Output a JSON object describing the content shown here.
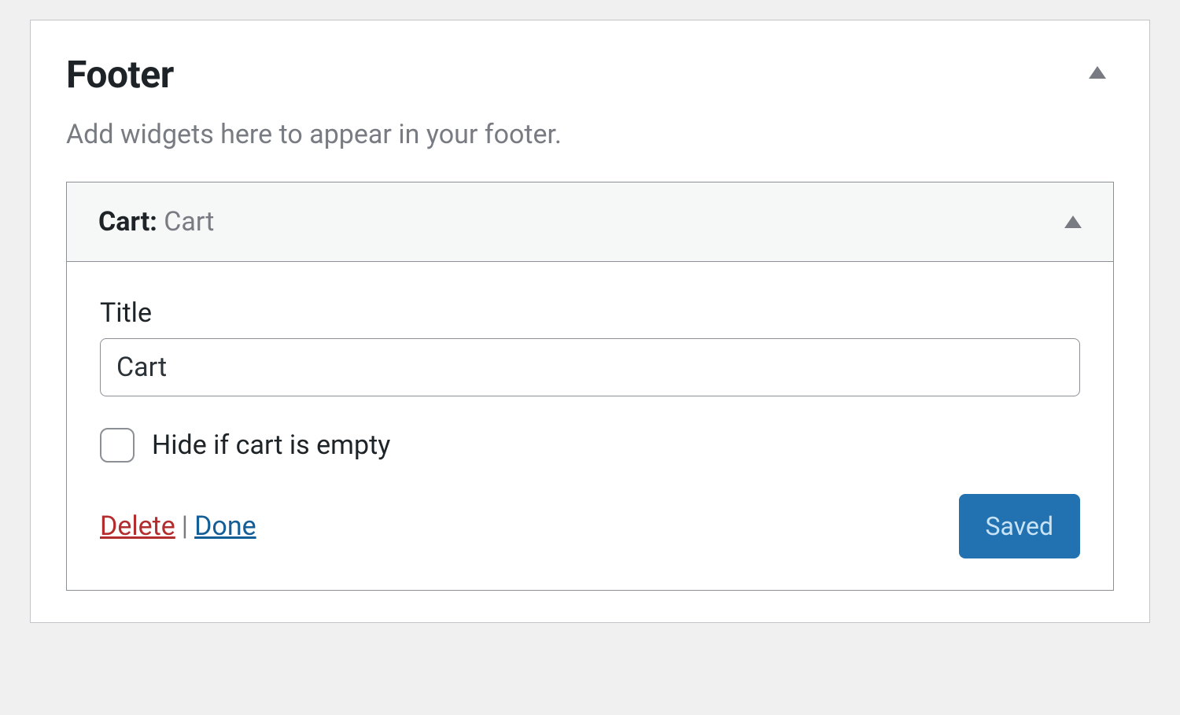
{
  "panel": {
    "title": "Footer",
    "description": "Add widgets here to appear in your footer."
  },
  "widget": {
    "type_label": "Cart",
    "separator": ": ",
    "instance_name": "Cart",
    "fields": {
      "title_label": "Title",
      "title_value": "Cart",
      "hide_empty_label": "Hide if cart is empty",
      "hide_empty_checked": false
    },
    "actions": {
      "delete": "Delete",
      "separator": " | ",
      "done": "Done",
      "saved_button": "Saved"
    }
  }
}
